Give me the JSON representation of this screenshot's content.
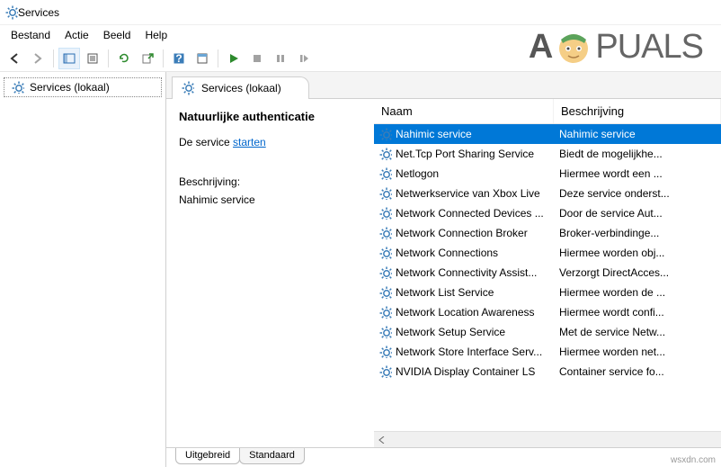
{
  "window": {
    "title": "Services"
  },
  "menu": {
    "file": "Bestand",
    "action": "Actie",
    "view": "Beeld",
    "help": "Help"
  },
  "tree": {
    "root": "Services (lokaal)"
  },
  "pane": {
    "heading": "Services (lokaal)"
  },
  "detail": {
    "title": "Natuurlijke authenticatie",
    "start_prefix": "De service ",
    "start_link": "starten",
    "desc_label": "Beschrijving:",
    "desc_text": "Nahimic service"
  },
  "columns": {
    "name": "Naam",
    "desc": "Beschrijving"
  },
  "services": [
    {
      "name": "Nahimic service",
      "desc": "Nahimic service",
      "selected": true
    },
    {
      "name": "Net.Tcp Port Sharing Service",
      "desc": "Biedt de mogelijkhe..."
    },
    {
      "name": "Netlogon",
      "desc": "Hiermee wordt een ..."
    },
    {
      "name": "Netwerkservice van Xbox Live",
      "desc": "Deze service onderst..."
    },
    {
      "name": "Network Connected Devices ...",
      "desc": "Door de service Aut..."
    },
    {
      "name": "Network Connection Broker",
      "desc": "Broker-verbindinge..."
    },
    {
      "name": "Network Connections",
      "desc": "Hiermee worden obj..."
    },
    {
      "name": "Network Connectivity Assist...",
      "desc": "Verzorgt DirectAcces..."
    },
    {
      "name": "Network List Service",
      "desc": "Hiermee worden de ..."
    },
    {
      "name": "Network Location Awareness",
      "desc": "Hiermee wordt confi..."
    },
    {
      "name": "Network Setup Service",
      "desc": "Met de service Netw..."
    },
    {
      "name": "Network Store Interface Serv...",
      "desc": "Hiermee worden net..."
    },
    {
      "name": "NVIDIA Display Container LS",
      "desc": "Container service fo..."
    }
  ],
  "tabs": {
    "extended": "Uitgebreid",
    "standard": "Standaard"
  },
  "watermark": {
    "brand_a": "A",
    "brand_b": "PUALS"
  },
  "footer": {
    "site": "wsxdn.com"
  },
  "icons": {
    "gear": "gear",
    "back": "back",
    "forward": "forward",
    "up": "up",
    "detail_pane": "detail-pane",
    "cut": "cut",
    "refresh": "refresh",
    "export": "export",
    "help": "help",
    "properties": "properties",
    "play": "play",
    "stop": "stop",
    "pause": "pause",
    "restart": "restart"
  }
}
